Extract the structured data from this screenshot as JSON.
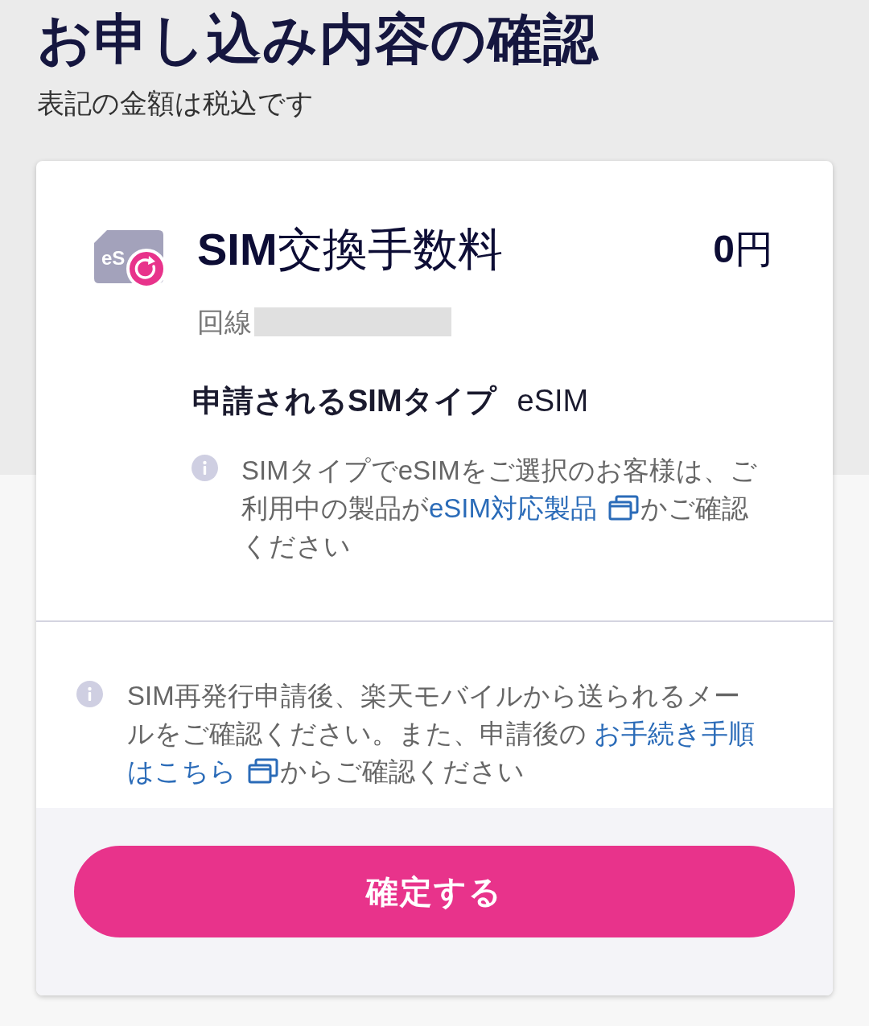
{
  "page": {
    "title": "お申し込み内容の確認",
    "subtitle": "表記の金額は税込です"
  },
  "item": {
    "icon_text": "eS",
    "name": "**SIM**交換手数料",
    "price": "**0**円",
    "line_label": "回線",
    "sim_type_label": "申請されるSIMタイプ",
    "sim_type_value": "eSIM",
    "note": [
      {
        "kind": "text",
        "text": "SIMタイプでeSIMをご選択のお客様は、ご利用中の製品が"
      },
      {
        "kind": "link",
        "text": "eSIM対応製品",
        "external": true
      },
      {
        "kind": "text",
        "text": "かご確認ください"
      }
    ]
  },
  "notice": [
    {
      "kind": "text",
      "text": "SIM再発行申請後、楽天モバイルから送られるメールをご確認ください。また、申請後の "
    },
    {
      "kind": "link",
      "text": "お手続き手順",
      "external": false
    },
    {
      "kind": "link",
      "text": "はこちら",
      "external": true
    },
    {
      "kind": "text",
      "text": "からご確認ください"
    }
  ],
  "confirm_button": {
    "label": "確定する"
  }
}
